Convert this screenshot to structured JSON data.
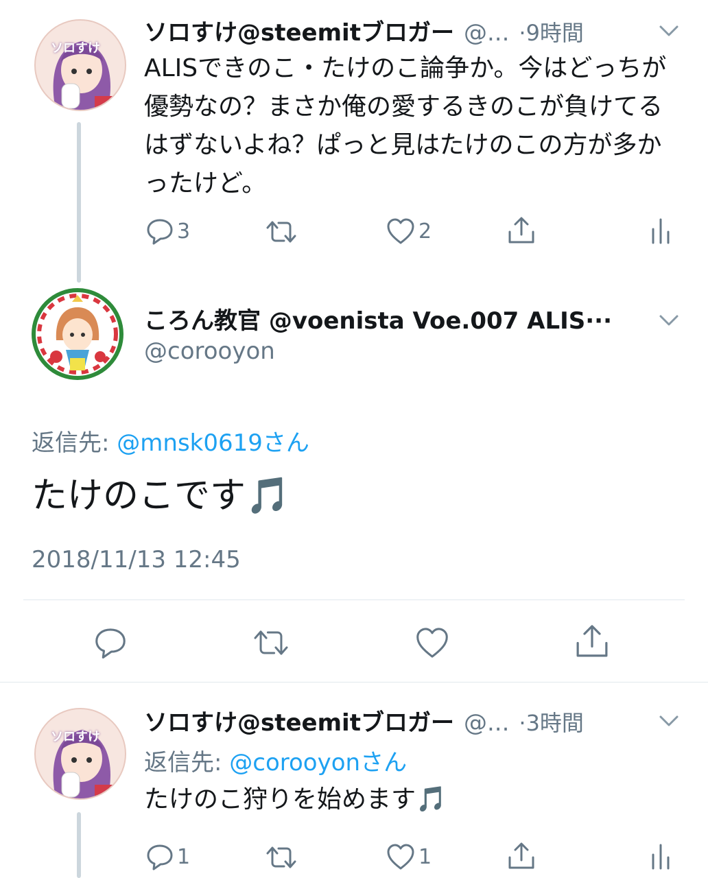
{
  "tweets": [
    {
      "display_name": "ソロすけ@steemitブロガー",
      "handle": "@...",
      "time": "·9時間",
      "text": "ALISできのこ・たけのこ論争か。今はどっちが優勢なの？まさか俺の愛するきのこが負けてるはずないよね？ぱっと見はたけのこの方が多かったけど。",
      "replies": "3",
      "retweets": "",
      "likes": "2",
      "avatar_text": "ソロすけ"
    },
    {
      "display_name": "ころん教官 @voenista Voe.007 ALIS···",
      "handle": "@corooyon",
      "reply_label": "返信先:",
      "reply_to": "@mnsk0619さん",
      "text": "たけのこです🎵",
      "timestamp": "2018/11/13 12:45"
    },
    {
      "display_name": "ソロすけ@steemitブロガー",
      "handle": "@...",
      "time": "·3時間",
      "reply_label": "返信先:",
      "reply_to": "@corooyonさん",
      "text": "たけのこ狩りを始めます🎵",
      "replies": "1",
      "retweets": "",
      "likes": "1",
      "avatar_text": "ソロすけ"
    }
  ],
  "colors": {
    "text": "#14171a",
    "muted": "#657786",
    "link": "#1da1f2",
    "divider": "#e1e8ed",
    "thread_line": "#ccd6dd"
  },
  "icons": [
    "reply-icon",
    "retweet-icon",
    "like-icon",
    "share-icon",
    "analytics-icon",
    "chevron-down-icon"
  ]
}
